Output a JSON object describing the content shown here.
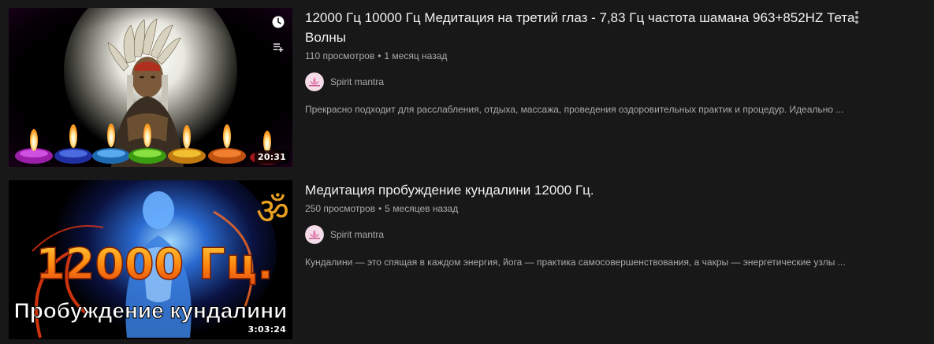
{
  "videos": [
    {
      "title": "12000 Гц 10000 Гц Медитация на третий глаз - 7,83 Гц частота шамана 963+852HZ Тета Волны",
      "views": "110 просмотров",
      "age": "1 месяц назад",
      "channel": "Spirit mantra",
      "description": "Прекрасно подходит для расслабления, отдыха, массажа, проведения оздоровительных практик и процедур. Идеально ...",
      "duration": "20:31",
      "hover_icons": [
        "clock-icon",
        "add-to-queue-icon"
      ],
      "menu_icon": "more-vert-icon"
    },
    {
      "title": "Медитация пробуждение кундалини 12000 Гц.",
      "views": "250 просмотров",
      "age": "5 месяцев назад",
      "channel": "Spirit mantra",
      "description": "Кундалини — это спящая в каждом энергия, йога — практика самосовершенствования, а чакры — энергетические узлы ...",
      "duration": "3:03:24",
      "thumb_text_big": "12000 Гц.",
      "thumb_text_small": "Пробуждение кундалини",
      "thumb_symbol": "ॐ"
    }
  ],
  "colors": {
    "background": "#181818",
    "title": "#f1f1f1",
    "secondary": "#aaaaaa"
  }
}
